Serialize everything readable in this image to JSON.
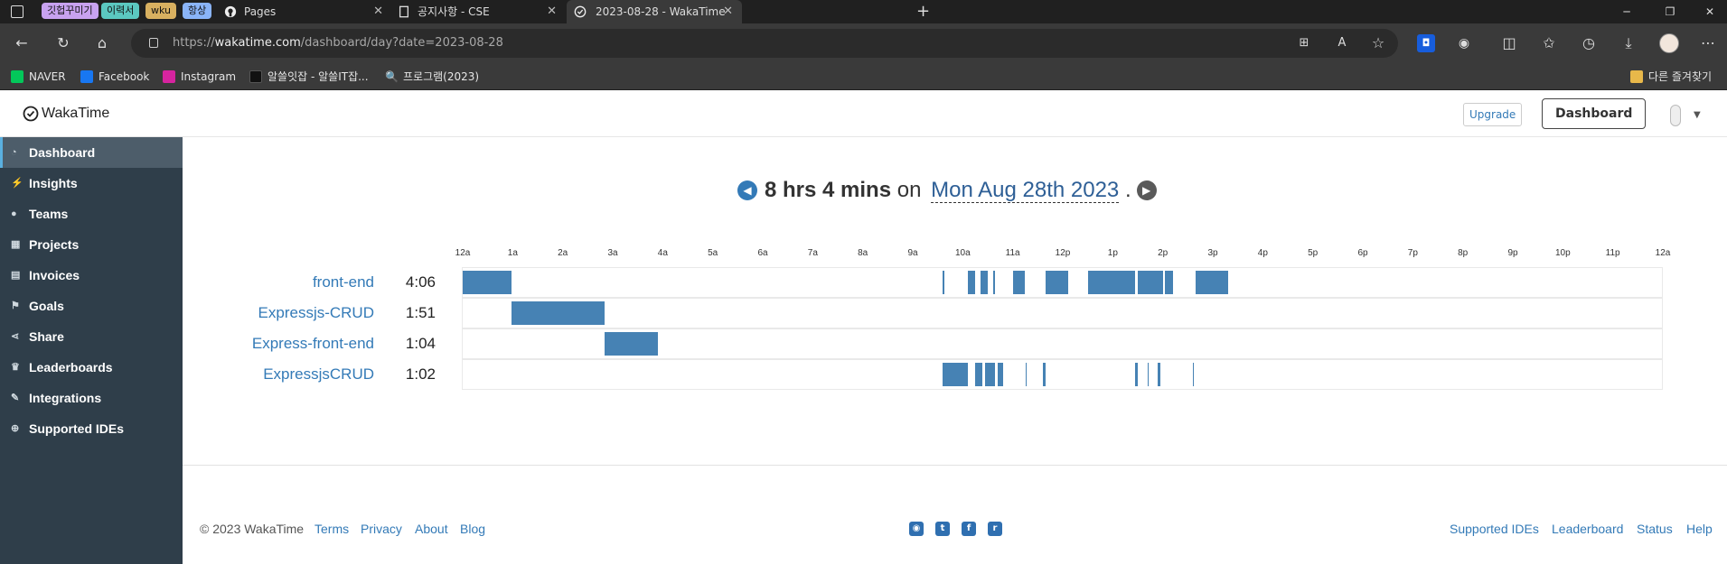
{
  "browser": {
    "tab_groups": [
      {
        "label": "깃헙꾸미기",
        "color": "#c8a2f0"
      },
      {
        "label": "이력서",
        "color": "#5bc8c0"
      },
      {
        "label": "wku",
        "color": "#d8b060"
      },
      {
        "label": "항상",
        "color": "#8ab4f8"
      }
    ],
    "tabs": [
      {
        "title": "Pages",
        "icon": "github-icon"
      },
      {
        "title": "공지사항 - CSE",
        "icon": "document-icon"
      },
      {
        "title": "2023-08-28 - WakaTime",
        "icon": "wakatime-icon",
        "active": true
      }
    ],
    "url_prefix": "https://",
    "url_host": "wakatime.com",
    "url_path": "/dashboard/day?date=2023-08-28",
    "bookmarks": [
      {
        "label": "NAVER",
        "color": "#03c75a"
      },
      {
        "label": "Facebook",
        "color": "#1877f2"
      },
      {
        "label": "Instagram",
        "color": "#d6249f"
      },
      {
        "label": "알쓸잇잡 - 알쓸IT잡...",
        "color": "#111111"
      },
      {
        "label": "프로그램(2023)",
        "color": "#3a3a3a"
      }
    ],
    "other_bookmarks": "다른 즐겨찾기"
  },
  "app": {
    "logo": "WakaTime",
    "upgrade": "Upgrade",
    "dashboard": "Dashboard"
  },
  "sidebar": {
    "items": [
      {
        "label": "Dashboard",
        "icon": "dashboard-icon",
        "active": true
      },
      {
        "label": "Insights",
        "icon": "bolt-icon"
      },
      {
        "label": "Teams",
        "icon": "users-icon"
      },
      {
        "label": "Projects",
        "icon": "grid-icon"
      },
      {
        "label": "Invoices",
        "icon": "file-icon"
      },
      {
        "label": "Goals",
        "icon": "flag-icon"
      },
      {
        "label": "Share",
        "icon": "share-icon"
      },
      {
        "label": "Leaderboards",
        "icon": "trophy-icon"
      },
      {
        "label": "Integrations",
        "icon": "wrench-icon"
      },
      {
        "label": "Supported IDEs",
        "icon": "plus-circle-icon"
      }
    ]
  },
  "summary": {
    "duration": "8 hrs 4 mins",
    "on": "on",
    "date": "Mon Aug 28th 2023",
    "period": "."
  },
  "chart_data": {
    "type": "timeline",
    "x_ticks": [
      "12a",
      "1a",
      "2a",
      "3a",
      "4a",
      "5a",
      "6a",
      "7a",
      "8a",
      "9a",
      "10a",
      "11a",
      "12p",
      "1p",
      "2p",
      "3p",
      "4p",
      "5p",
      "6p",
      "7p",
      "8p",
      "9p",
      "10p",
      "11p",
      "12a"
    ],
    "xlim_hours": [
      0,
      24
    ],
    "color": "#4682b4",
    "projects": [
      {
        "name": "front-end",
        "total": "4:06",
        "segments": [
          [
            0.0,
            0.97
          ],
          [
            9.6,
            9.63
          ],
          [
            10.1,
            10.25
          ],
          [
            10.35,
            10.5
          ],
          [
            10.6,
            10.65
          ],
          [
            11.0,
            11.25
          ],
          [
            11.65,
            12.1
          ],
          [
            12.5,
            13.45
          ],
          [
            13.5,
            14.0
          ],
          [
            14.05,
            14.2
          ],
          [
            14.65,
            15.3
          ]
        ]
      },
      {
        "name": "Expressjs-CRUD",
        "total": "1:51",
        "segments": [
          [
            0.97,
            2.83
          ]
        ]
      },
      {
        "name": "Express-front-end",
        "total": "1:04",
        "segments": [
          [
            2.83,
            3.9
          ]
        ]
      },
      {
        "name": "ExpressjsCRUD",
        "total": "1:02",
        "segments": [
          [
            9.6,
            10.1
          ],
          [
            10.25,
            10.4
          ],
          [
            10.45,
            10.65
          ],
          [
            10.7,
            10.8
          ],
          [
            11.25,
            11.27
          ],
          [
            11.6,
            11.65
          ],
          [
            13.45,
            13.5
          ],
          [
            13.7,
            13.72
          ],
          [
            13.9,
            13.95
          ],
          [
            14.6,
            14.62
          ]
        ]
      }
    ]
  },
  "footer": {
    "copyright": "© 2023 WakaTime",
    "left_links": [
      "Terms",
      "Privacy",
      "About",
      "Blog"
    ],
    "right_links": [
      "Supported IDEs",
      "Leaderboard",
      "Status",
      "Help"
    ],
    "social": [
      "github-icon",
      "twitter-icon",
      "facebook-icon",
      "reddit-icon"
    ]
  }
}
